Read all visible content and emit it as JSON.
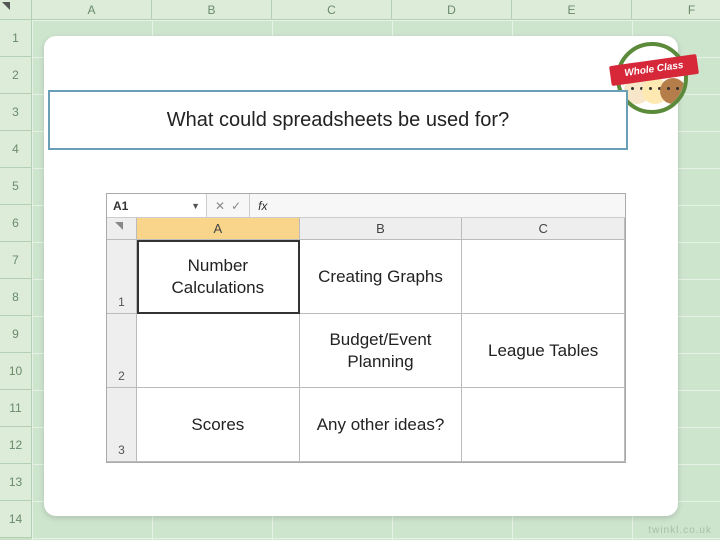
{
  "background_grid": {
    "columns": [
      "A",
      "B",
      "C",
      "D",
      "E",
      "F"
    ],
    "rows": [
      "1",
      "2",
      "3",
      "4",
      "5",
      "6",
      "7",
      "8",
      "9",
      "10",
      "11",
      "12",
      "13",
      "14"
    ]
  },
  "badge": {
    "ribbon_text": "Whole Class"
  },
  "prompt": {
    "text": "What could spreadsheets be used for?"
  },
  "sheet": {
    "namebox_value": "A1",
    "fx_label": "fx",
    "columns": [
      "A",
      "B",
      "C"
    ],
    "rows": [
      "1",
      "2",
      "3"
    ],
    "cells": [
      [
        "Number Calculations",
        "Creating Graphs",
        ""
      ],
      [
        "",
        "Budget/Event Planning",
        "League Tables"
      ],
      [
        "Scores",
        "Any other ideas?",
        ""
      ]
    ],
    "selected_cell": "A1"
  },
  "watermark": "twinkl.co.uk"
}
